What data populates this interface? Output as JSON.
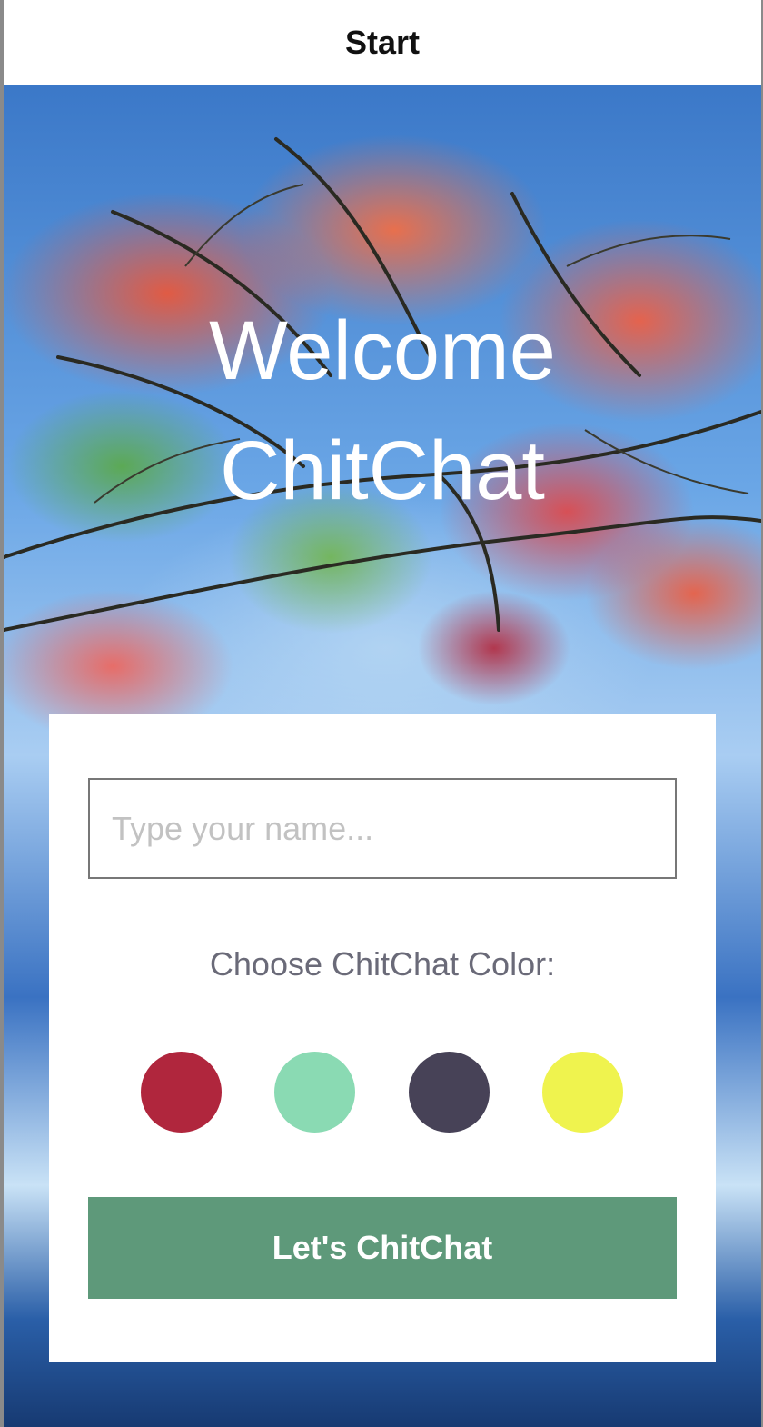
{
  "nav": {
    "title": "Start"
  },
  "hero": {
    "line1": "Welcome",
    "line2": "ChitChat"
  },
  "form": {
    "name_placeholder": "Type your name...",
    "name_value": "",
    "color_label": "Choose ChitChat Color:",
    "colors": [
      {
        "name": "red",
        "hex": "#b0263d"
      },
      {
        "name": "mint",
        "hex": "#8adab3"
      },
      {
        "name": "dark-slate",
        "hex": "#474257"
      },
      {
        "name": "yellow",
        "hex": "#eff34e"
      }
    ],
    "button_label": "Let's ChitChat"
  }
}
